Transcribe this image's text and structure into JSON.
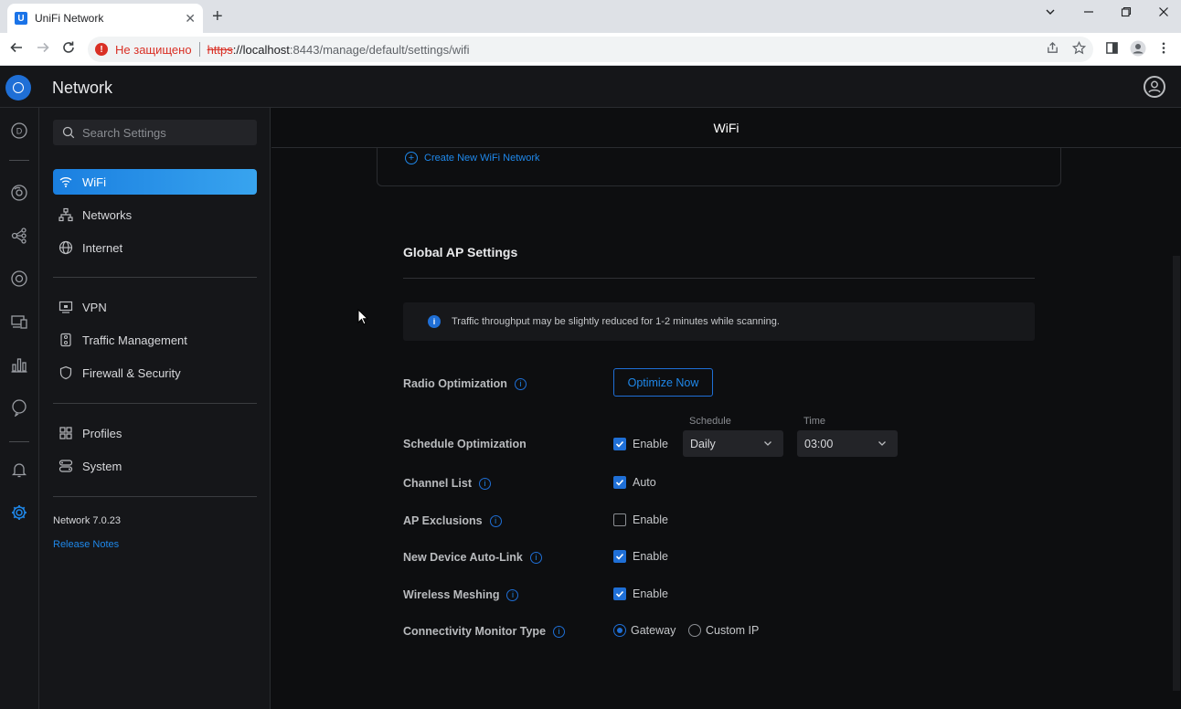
{
  "browser": {
    "tab_title": "UniFi Network",
    "tab_favicon": "U",
    "new_tab": "+",
    "not_secure": "Не защищено",
    "url_proto": "https",
    "url_host": "://localhost",
    "url_rest": ":8443/manage/default/settings/wifi"
  },
  "app": {
    "title": "Network"
  },
  "sidebar": {
    "search_placeholder": "Search Settings",
    "items": [
      {
        "label": "WiFi",
        "icon": "wifi-icon"
      },
      {
        "label": "Networks",
        "icon": "networks-icon"
      },
      {
        "label": "Internet",
        "icon": "globe-icon"
      },
      {
        "label": "VPN",
        "icon": "vpn-icon"
      },
      {
        "label": "Traffic Management",
        "icon": "traffic-icon"
      },
      {
        "label": "Firewall & Security",
        "icon": "shield-icon"
      },
      {
        "label": "Profiles",
        "icon": "profiles-icon"
      },
      {
        "label": "System",
        "icon": "system-icon"
      }
    ],
    "version": "Network 7.0.23",
    "release_notes": "Release Notes"
  },
  "main": {
    "page_title": "WiFi",
    "create_wifi": "Create New WiFi Network",
    "section_title": "Global AP Settings",
    "info_text": "Traffic throughput may be slightly reduced for 1-2 minutes while scanning.",
    "radio_optimization": {
      "label": "Radio Optimization",
      "button": "Optimize Now"
    },
    "schedule_optimization": {
      "label": "Schedule Optimization",
      "enable": "Enable",
      "checked": true,
      "schedule_label": "Schedule",
      "schedule_value": "Daily",
      "time_label": "Time",
      "time_value": "03:00"
    },
    "channel_list": {
      "label": "Channel List",
      "option": "Auto",
      "checked": true
    },
    "ap_exclusions": {
      "label": "AP Exclusions",
      "option": "Enable",
      "checked": false
    },
    "auto_link": {
      "label": "New Device Auto-Link",
      "option": "Enable",
      "checked": true
    },
    "wireless_meshing": {
      "label": "Wireless Meshing",
      "option": "Enable",
      "checked": true
    },
    "connectivity": {
      "label": "Connectivity Monitor Type",
      "option1": "Gateway",
      "option2": "Custom IP",
      "selected": "Gateway"
    }
  },
  "colors": {
    "accent": "#1f6fd6",
    "background": "#0d0e10",
    "panel": "#151619"
  }
}
